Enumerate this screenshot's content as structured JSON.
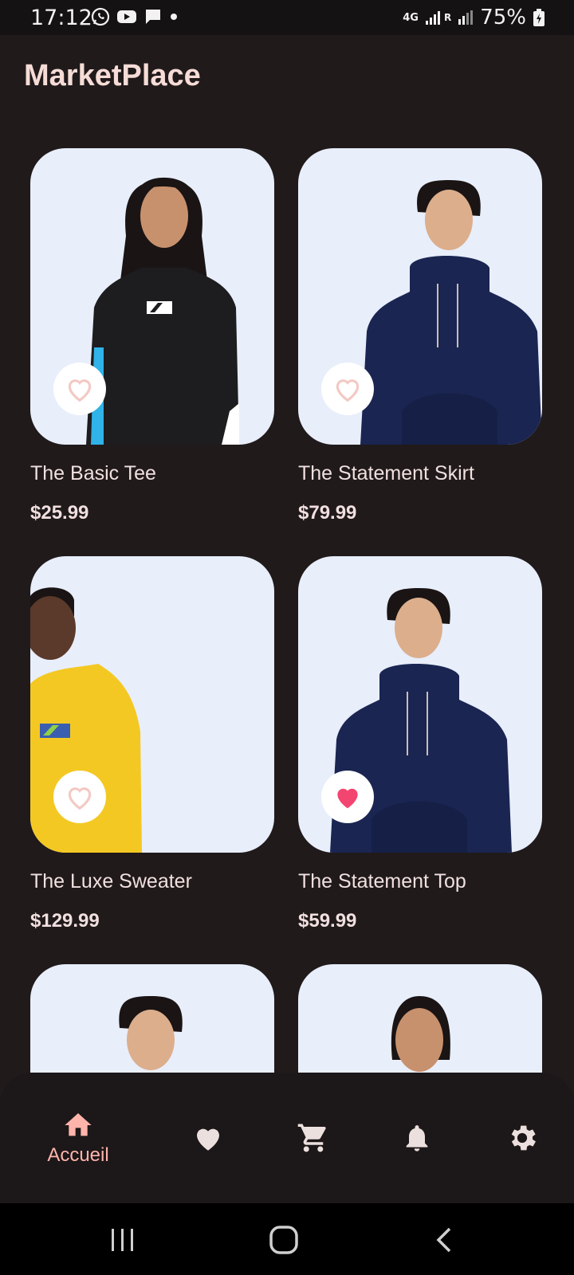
{
  "status": {
    "time": "17:12",
    "battery": "75%",
    "network": "4G",
    "roaming": "R"
  },
  "app": {
    "title": "MarketPlace"
  },
  "products": [
    {
      "name": "The Basic Tee",
      "price": "$25.99",
      "favorite": false,
      "garment_color": "#1d1d1f",
      "image": "model-black-hoodie"
    },
    {
      "name": "The Statement Skirt",
      "price": "$79.99",
      "favorite": false,
      "garment_color": "#1a2552",
      "image": "model-navy-hoodie"
    },
    {
      "name": "The Luxe Sweater",
      "price": "$129.99",
      "favorite": false,
      "garment_color": "#f4c823",
      "image": "model-yellow-hoodie"
    },
    {
      "name": "The Statement Top",
      "price": "$59.99",
      "favorite": true,
      "garment_color": "#1a2552",
      "image": "model-navy-hoodie"
    },
    {
      "name": "",
      "price": "",
      "favorite": false,
      "garment_color": "#1a2552",
      "image": "model-partial"
    },
    {
      "name": "",
      "price": "",
      "favorite": false,
      "garment_color": "#1d1d1f",
      "image": "model-partial"
    }
  ],
  "nav": {
    "items": [
      {
        "label": "Accueil",
        "icon": "home-icon",
        "active": true
      },
      {
        "label": "",
        "icon": "heart-icon",
        "active": false
      },
      {
        "label": "",
        "icon": "cart-icon",
        "active": false
      },
      {
        "label": "",
        "icon": "bell-icon",
        "active": false
      },
      {
        "label": "",
        "icon": "gear-icon",
        "active": false
      }
    ]
  },
  "colors": {
    "background": "#201a1b",
    "accent": "#ffb4ab",
    "favorite_active": "#f2456f",
    "favorite_inactive": "#f3c9c3",
    "card_background": "#e8eefa"
  }
}
